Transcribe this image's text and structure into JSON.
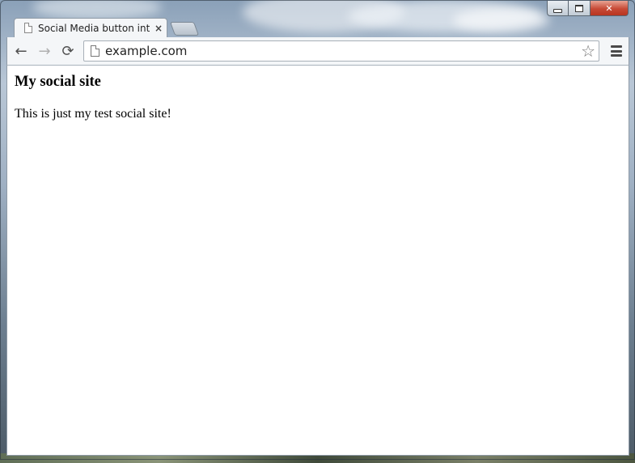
{
  "window": {
    "caption": {
      "minimize_icon": "minimize-icon",
      "maximize_icon": "maximize-icon",
      "close_icon": "close-icon",
      "close_glyph": "✕"
    }
  },
  "tabs": [
    {
      "title": "Social Media button integ",
      "active": true,
      "close_glyph": "×"
    }
  ],
  "toolbar": {
    "back_glyph": "←",
    "forward_glyph": "→",
    "reload_glyph": "⟳",
    "address_value": "example.com",
    "star_glyph": "☆"
  },
  "page": {
    "heading": "My social site",
    "text": "This is just my test social site!"
  },
  "colors": {
    "close_button": "#c74a36",
    "chrome_frame": "#f4f6f8"
  }
}
